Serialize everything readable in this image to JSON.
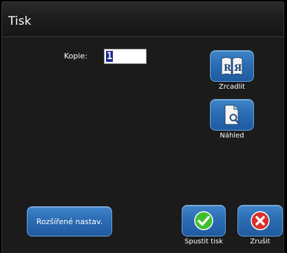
{
  "dialog": {
    "title": "Tisk"
  },
  "copies": {
    "label": "Kopie:",
    "value": "1"
  },
  "buttons": {
    "mirror": {
      "label": "Zrcadlit",
      "icon": "mirror-icon"
    },
    "preview": {
      "label": "Náhled",
      "icon": "preview-icon"
    },
    "advanced": {
      "label": "Rozšířené nastav."
    },
    "start": {
      "label": "Spustit tisk",
      "icon": "check-icon"
    },
    "cancel": {
      "label": "Zrušit",
      "icon": "cancel-icon"
    }
  },
  "colors": {
    "button_blue": "#2b6db4",
    "confirm_green": "#3fbf2f",
    "cancel_red": "#d8302a"
  }
}
